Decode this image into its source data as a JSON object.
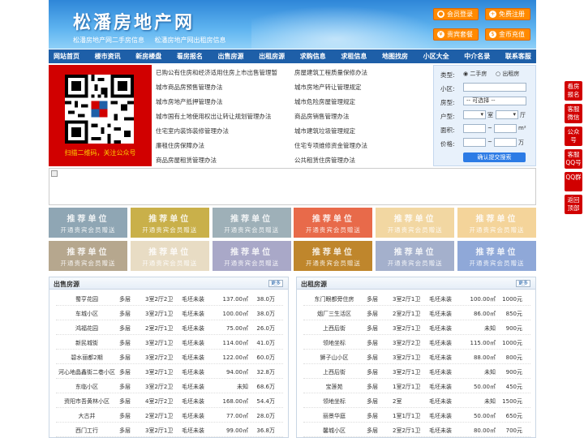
{
  "header": {
    "title": "松潘房地产网",
    "sub_links": [
      "松潘房地产网二手房信息",
      "松潘房地产网出租房信息"
    ],
    "buttons": [
      "会员登录",
      "免费注册",
      "贵宾套餐",
      "金币充值"
    ]
  },
  "nav": [
    "网站首页",
    "楼市资讯",
    "新房楼盘",
    "看房报名",
    "出售房源",
    "出租房源",
    "求购信息",
    "求租信息",
    "地图找房",
    "小区大全",
    "中介名录",
    "联系客服"
  ],
  "qr_caption": "扫描二维码，关注公众号",
  "links": [
    [
      "已购公有住房和经济适用住房上市出售管理暂",
      "房屋建筑工程质量保修办法"
    ],
    [
      "城市商品房预售管理办法",
      "城市房地产转让管理规定"
    ],
    [
      "城市房地产抵押管理办法",
      "城市危险房屋管理规定"
    ],
    [
      "城市国有土地使用权出让转让规划管理办法",
      "商品房销售管理办法"
    ],
    [
      "住宅室内装饰装修管理办法",
      "城市建筑垃圾管理规定"
    ],
    [
      "廉租住房保障办法",
      "住宅专项维修资金管理办法"
    ],
    [
      "商品房屋租赁管理办法",
      "公共租赁住房管理办法"
    ]
  ],
  "search": {
    "type_label": "类型:",
    "type_options": [
      "二手房",
      "出租房"
    ],
    "community_label": "小区:",
    "housetype_label": "房型:",
    "housetype_value": "-- 可选择 --",
    "layout_label": "户型:",
    "room_unit": "室",
    "hall_unit": "厅",
    "area_label": "面积:",
    "area_unit": "m²",
    "price_label": "价格:",
    "price_unit": "万",
    "submit": "确认提交搜索"
  },
  "promo": {
    "line1": "推荐单位",
    "line2": "开通贵宾会员赠送",
    "colors": [
      "#8fa6b4",
      "#c9b04a",
      "#9eb0b8",
      "#e86a4a",
      "#f2d7a2",
      "#f4d49a",
      "#b6a78e",
      "#e8dcc4",
      "#a9a8c8",
      "#bf862c",
      "#a4b0cc",
      "#8fa8d8"
    ]
  },
  "sale": {
    "title": "出售房源",
    "more": "更多",
    "rows": [
      [
        "蜀亨花园",
        "多层",
        "3室2厅2卫",
        "毛坯未装",
        "137.00㎡",
        "38.0万"
      ],
      [
        "车城小区",
        "多层",
        "3室2厅1卫",
        "毛坯未装",
        "100.00㎡",
        "38.0万"
      ],
      [
        "鸿福花园",
        "多层",
        "2室2厅1卫",
        "毛坯未装",
        "75.00㎡",
        "26.0万"
      ],
      [
        "新民城街",
        "多层",
        "3室2厅1卫",
        "毛坯未装",
        "114.00㎡",
        "41.0万"
      ],
      [
        "碧水丽都2期",
        "多层",
        "3室2厅2卫",
        "毛坯未装",
        "122.00㎡",
        "60.0万"
      ],
      [
        "河心地晶鑫街二巷小区",
        "多层",
        "3室2厅1卫",
        "毛坯未装",
        "94.00㎡",
        "32.8万"
      ],
      [
        "东临小区",
        "多层",
        "3室2厅2卫",
        "毛坯未装",
        "未知",
        "68.6万"
      ],
      [
        "资阳市吾黄林小区",
        "多层",
        "4室2厅2卫",
        "毛坯未装",
        "168.00㎡",
        "54.4万"
      ],
      [
        "大古井",
        "多层",
        "2室2厅1卫",
        "毛坯未装",
        "77.00㎡",
        "28.0万"
      ],
      [
        "西门工行",
        "多层",
        "3室2厅1卫",
        "毛坯未装",
        "99.00㎡",
        "36.8万"
      ]
    ]
  },
  "rent": {
    "title": "出租房源",
    "more": "更多",
    "rows": [
      [
        "东门眼都旁住房",
        "多层",
        "3室2厅1卫",
        "毛坯未装",
        "100.00㎡",
        "1000元"
      ],
      [
        "烟厂三生活区",
        "多层",
        "2室2厅1卫",
        "毛坯未装",
        "86.00㎡",
        "850元"
      ],
      [
        "上西后街",
        "多层",
        "3室2厅1卫",
        "毛坯未装",
        "未知",
        "900元"
      ],
      [
        "领地坐标",
        "多层",
        "3室2厅2卫",
        "毛坯未装",
        "115.00㎡",
        "1000元"
      ],
      [
        "狮子山小区",
        "多层",
        "3室2厅1卫",
        "毛坯未装",
        "88.00㎡",
        "800元"
      ],
      [
        "上西后街",
        "多层",
        "3室2厅1卫",
        "毛坯未装",
        "未知",
        "900元"
      ],
      [
        "宝莲苑",
        "多层",
        "1室2厅1卫",
        "毛坯未装",
        "50.00㎡",
        "450元"
      ],
      [
        "领地坐标",
        "多层",
        "2室",
        "毛坯未装",
        "未知",
        "1500元"
      ],
      [
        "丽景华庭",
        "多层",
        "1室1厅1卫",
        "毛坯未装",
        "50.00㎡",
        "650元"
      ],
      [
        "馨城小区",
        "多层",
        "2室2厅1卫",
        "毛坯未装",
        "80.00㎡",
        "700元"
      ]
    ]
  },
  "side": [
    "看房报名",
    "客服微信",
    "公众号",
    "客服QQ号",
    "QQ群",
    "返回顶部"
  ]
}
